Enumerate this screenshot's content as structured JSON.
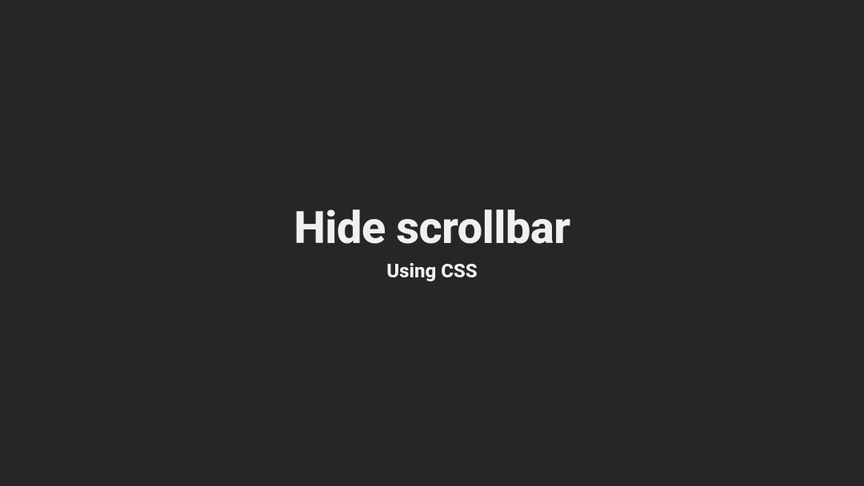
{
  "title": "Hide scrollbar",
  "subtitle": "Using CSS"
}
